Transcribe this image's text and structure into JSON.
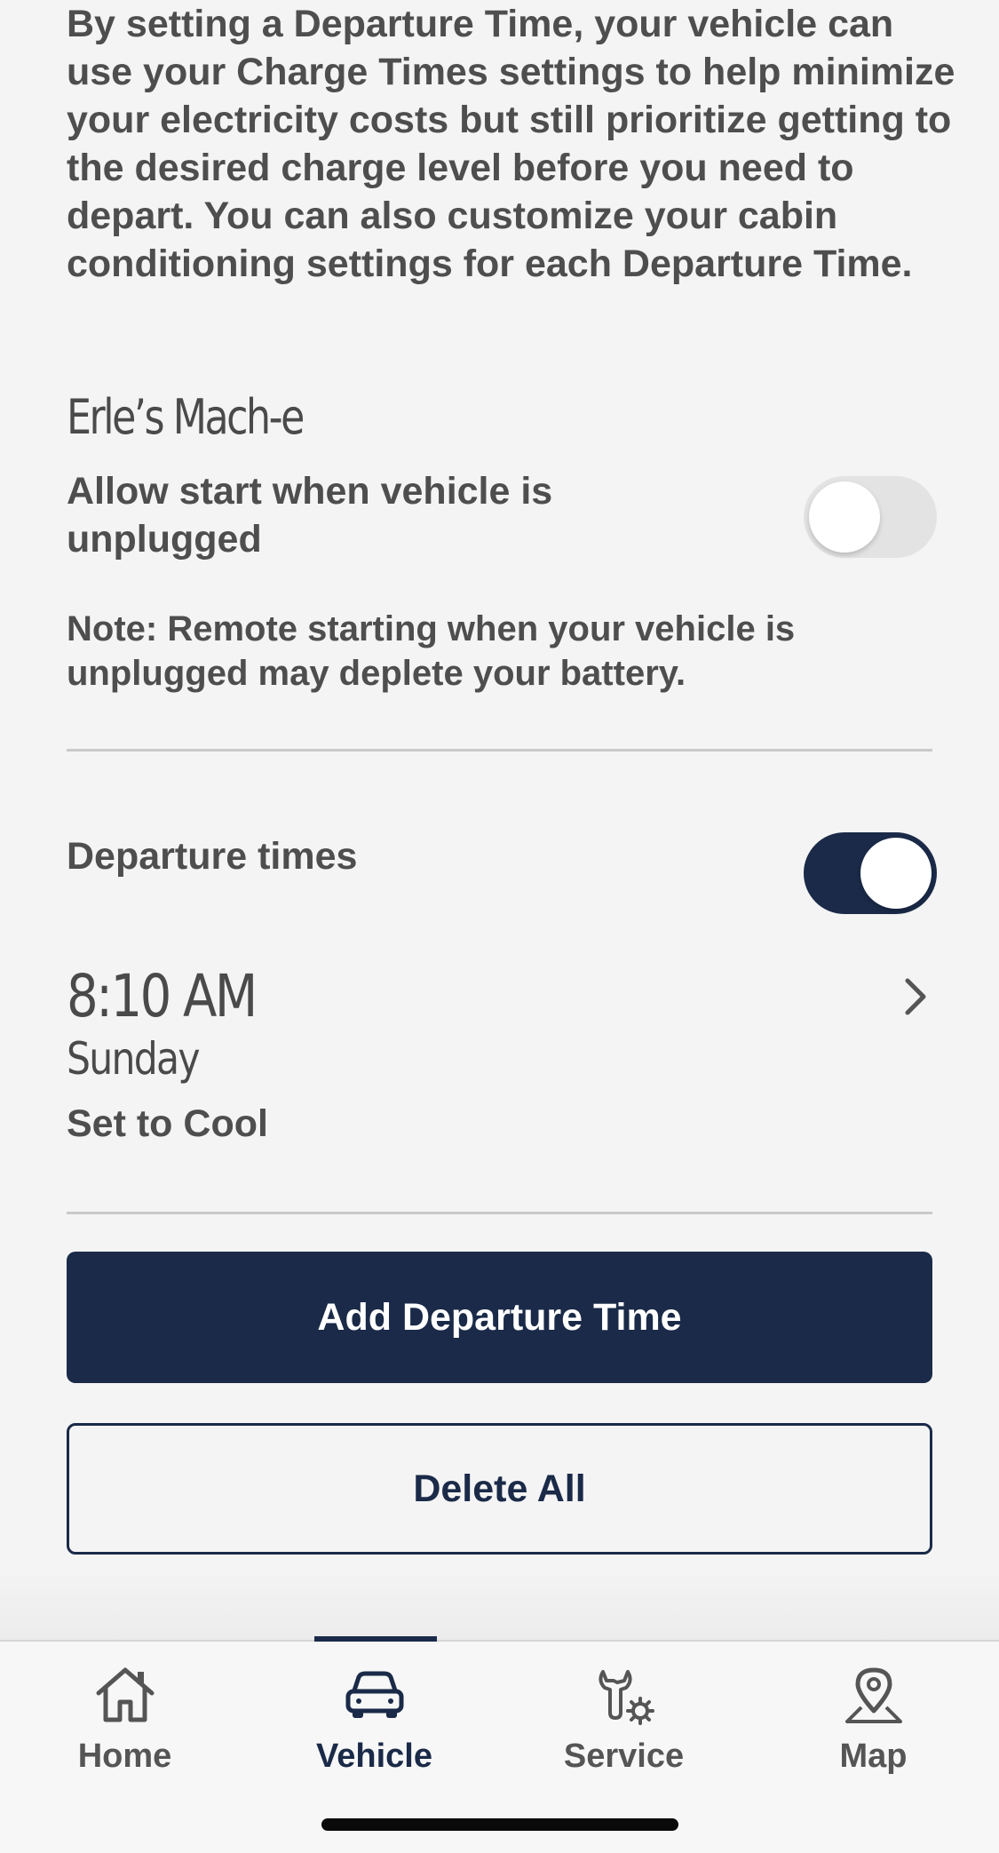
{
  "intro_text": "By setting a Departure Time, your vehicle can use your Charge Times settings to help minimize your electricity costs but still prioritize getting to the desired charge level before you need to depart. You can also customize your cabin conditioning settings for each Departure Time.",
  "vehicle": {
    "name": "Erle’s Mach-e"
  },
  "unplugged_setting": {
    "label": "Allow start when vehicle is unplugged",
    "enabled": false,
    "note": "Note: Remote starting when your vehicle is unplugged may deplete your battery."
  },
  "departure_times": {
    "label": "Departure times",
    "enabled": true,
    "items": [
      {
        "time": "8:10 AM",
        "day": "Sunday",
        "mode": "Set to Cool"
      }
    ]
  },
  "buttons": {
    "add": "Add Departure Time",
    "delete_all": "Delete All"
  },
  "tabbar": {
    "active": "Vehicle",
    "items": [
      {
        "label": "Home",
        "icon": "home-icon"
      },
      {
        "label": "Vehicle",
        "icon": "car-icon"
      },
      {
        "label": "Service",
        "icon": "wrench-gear-icon"
      },
      {
        "label": "Map",
        "icon": "map-pin-icon"
      }
    ]
  },
  "colors": {
    "accent": "#1a2a48",
    "background": "#f4f4f4",
    "text": "#4e4e4e"
  }
}
